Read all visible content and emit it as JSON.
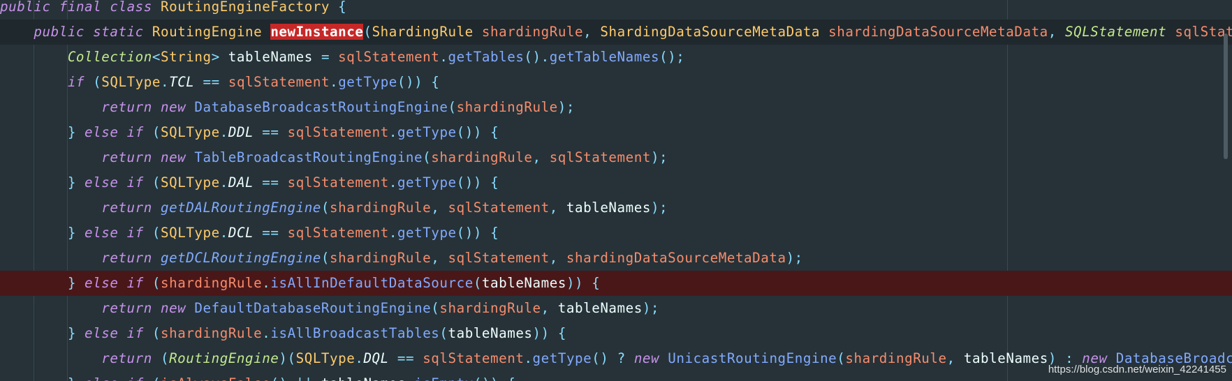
{
  "editor": {
    "lines": [
      {
        "tokens": [
          [
            "kw",
            "public"
          ],
          [
            "plain",
            " "
          ],
          [
            "kw",
            "final"
          ],
          [
            "plain",
            " "
          ],
          [
            "kw",
            "class"
          ],
          [
            "plain",
            " "
          ],
          [
            "type",
            "RoutingEngineFactory"
          ],
          [
            "plain",
            " "
          ],
          [
            "punc",
            "{"
          ]
        ]
      },
      {
        "tokens": [
          [
            "plain",
            "    "
          ],
          [
            "kw",
            "public"
          ],
          [
            "plain",
            " "
          ],
          [
            "kw",
            "static"
          ],
          [
            "plain",
            " "
          ],
          [
            "type",
            "RoutingEngine"
          ],
          [
            "plain",
            " "
          ],
          [
            "hl",
            "newInstance"
          ],
          [
            "punc",
            "("
          ],
          [
            "type",
            "ShardingRule"
          ],
          [
            "plain",
            " "
          ],
          [
            "var",
            "shardingRule"
          ],
          [
            "punc",
            ","
          ],
          [
            "plain",
            " "
          ],
          [
            "type",
            "ShardingDataSourceMetaData"
          ],
          [
            "plain",
            " "
          ],
          [
            "var",
            "shardingDataSourceMetaData"
          ],
          [
            "punc",
            ","
          ],
          [
            "plain",
            " "
          ],
          [
            "itype",
            "SQLStatement"
          ],
          [
            "plain",
            " "
          ],
          [
            "var",
            "sqlStatement"
          ]
        ]
      },
      {
        "tokens": [
          [
            "plain",
            "        "
          ],
          [
            "itype",
            "Collection"
          ],
          [
            "punc",
            "<"
          ],
          [
            "type",
            "String"
          ],
          [
            "punc",
            ">"
          ],
          [
            "plain",
            " tableNames "
          ],
          [
            "punc",
            "="
          ],
          [
            "plain",
            " "
          ],
          [
            "var",
            "sqlStatement"
          ],
          [
            "punc",
            "."
          ],
          [
            "fn",
            "getTables"
          ],
          [
            "punc",
            "()."
          ],
          [
            "fn",
            "getTableNames"
          ],
          [
            "punc",
            "();"
          ]
        ]
      },
      {
        "tokens": [
          [
            "plain",
            "        "
          ],
          [
            "kw",
            "if"
          ],
          [
            "plain",
            " "
          ],
          [
            "punc",
            "("
          ],
          [
            "type",
            "SQLType"
          ],
          [
            "punc",
            "."
          ],
          [
            "cst",
            "TCL"
          ],
          [
            "plain",
            " "
          ],
          [
            "punc",
            "=="
          ],
          [
            "plain",
            " "
          ],
          [
            "var",
            "sqlStatement"
          ],
          [
            "punc",
            "."
          ],
          [
            "fn",
            "getType"
          ],
          [
            "punc",
            "())"
          ],
          [
            "plain",
            " "
          ],
          [
            "punc",
            "{"
          ]
        ]
      },
      {
        "tokens": [
          [
            "plain",
            "            "
          ],
          [
            "kw",
            "return"
          ],
          [
            "plain",
            " "
          ],
          [
            "kw",
            "new"
          ],
          [
            "plain",
            " "
          ],
          [
            "cls",
            "DatabaseBroadcastRoutingEngine"
          ],
          [
            "punc",
            "("
          ],
          [
            "var",
            "shardingRule"
          ],
          [
            "punc",
            ");"
          ]
        ]
      },
      {
        "tokens": [
          [
            "plain",
            "        "
          ],
          [
            "punc",
            "}"
          ],
          [
            "plain",
            " "
          ],
          [
            "kw",
            "else"
          ],
          [
            "plain",
            " "
          ],
          [
            "kw",
            "if"
          ],
          [
            "plain",
            " "
          ],
          [
            "punc",
            "("
          ],
          [
            "type",
            "SQLType"
          ],
          [
            "punc",
            "."
          ],
          [
            "cst",
            "DDL"
          ],
          [
            "plain",
            " "
          ],
          [
            "punc",
            "=="
          ],
          [
            "plain",
            " "
          ],
          [
            "var",
            "sqlStatement"
          ],
          [
            "punc",
            "."
          ],
          [
            "fn",
            "getType"
          ],
          [
            "punc",
            "())"
          ],
          [
            "plain",
            " "
          ],
          [
            "punc",
            "{"
          ]
        ]
      },
      {
        "tokens": [
          [
            "plain",
            "            "
          ],
          [
            "kw",
            "return"
          ],
          [
            "plain",
            " "
          ],
          [
            "kw",
            "new"
          ],
          [
            "plain",
            " "
          ],
          [
            "cls",
            "TableBroadcastRoutingEngine"
          ],
          [
            "punc",
            "("
          ],
          [
            "var",
            "shardingRule"
          ],
          [
            "punc",
            ","
          ],
          [
            "plain",
            " "
          ],
          [
            "var",
            "sqlStatement"
          ],
          [
            "punc",
            ");"
          ]
        ]
      },
      {
        "tokens": [
          [
            "plain",
            "        "
          ],
          [
            "punc",
            "}"
          ],
          [
            "plain",
            " "
          ],
          [
            "kw",
            "else"
          ],
          [
            "plain",
            " "
          ],
          [
            "kw",
            "if"
          ],
          [
            "plain",
            " "
          ],
          [
            "punc",
            "("
          ],
          [
            "type",
            "SQLType"
          ],
          [
            "punc",
            "."
          ],
          [
            "cst",
            "DAL"
          ],
          [
            "plain",
            " "
          ],
          [
            "punc",
            "=="
          ],
          [
            "plain",
            " "
          ],
          [
            "var",
            "sqlStatement"
          ],
          [
            "punc",
            "."
          ],
          [
            "fn",
            "getType"
          ],
          [
            "punc",
            "())"
          ],
          [
            "plain",
            " "
          ],
          [
            "punc",
            "{"
          ]
        ]
      },
      {
        "tokens": [
          [
            "plain",
            "            "
          ],
          [
            "kw",
            "return"
          ],
          [
            "plain",
            " "
          ],
          [
            "ifn",
            "getDALRoutingEngine"
          ],
          [
            "punc",
            "("
          ],
          [
            "var",
            "shardingRule"
          ],
          [
            "punc",
            ","
          ],
          [
            "plain",
            " "
          ],
          [
            "var",
            "sqlStatement"
          ],
          [
            "punc",
            ","
          ],
          [
            "plain",
            " tableNames"
          ],
          [
            "punc",
            ");"
          ]
        ]
      },
      {
        "tokens": [
          [
            "plain",
            "        "
          ],
          [
            "punc",
            "}"
          ],
          [
            "plain",
            " "
          ],
          [
            "kw",
            "else"
          ],
          [
            "plain",
            " "
          ],
          [
            "kw",
            "if"
          ],
          [
            "plain",
            " "
          ],
          [
            "punc",
            "("
          ],
          [
            "type",
            "SQLType"
          ],
          [
            "punc",
            "."
          ],
          [
            "cst",
            "DCL"
          ],
          [
            "plain",
            " "
          ],
          [
            "punc",
            "=="
          ],
          [
            "plain",
            " "
          ],
          [
            "var",
            "sqlStatement"
          ],
          [
            "punc",
            "."
          ],
          [
            "fn",
            "getType"
          ],
          [
            "punc",
            "())"
          ],
          [
            "plain",
            " "
          ],
          [
            "punc",
            "{"
          ]
        ]
      },
      {
        "tokens": [
          [
            "plain",
            "            "
          ],
          [
            "kw",
            "return"
          ],
          [
            "plain",
            " "
          ],
          [
            "ifn",
            "getDCLRoutingEngine"
          ],
          [
            "punc",
            "("
          ],
          [
            "var",
            "shardingRule"
          ],
          [
            "punc",
            ","
          ],
          [
            "plain",
            " "
          ],
          [
            "var",
            "sqlStatement"
          ],
          [
            "punc",
            ","
          ],
          [
            "plain",
            " "
          ],
          [
            "var",
            "shardingDataSourceMetaData"
          ],
          [
            "punc",
            ");"
          ]
        ]
      },
      {
        "tokens": [
          [
            "plain",
            "        "
          ],
          [
            "punc",
            "}"
          ],
          [
            "plain",
            " "
          ],
          [
            "kw",
            "else"
          ],
          [
            "plain",
            " "
          ],
          [
            "kw",
            "if"
          ],
          [
            "plain",
            " "
          ],
          [
            "punc",
            "("
          ],
          [
            "var",
            "shardingRule"
          ],
          [
            "punc",
            "."
          ],
          [
            "fn",
            "isAllInDefaultDataSource"
          ],
          [
            "punc",
            "("
          ],
          [
            "plain",
            "tableNames"
          ],
          [
            "punc",
            "))"
          ],
          [
            "plain",
            " "
          ],
          [
            "punc",
            "{"
          ]
        ]
      },
      {
        "tokens": [
          [
            "plain",
            "            "
          ],
          [
            "kw",
            "return"
          ],
          [
            "plain",
            " "
          ],
          [
            "kw",
            "new"
          ],
          [
            "plain",
            " "
          ],
          [
            "cls",
            "DefaultDatabaseRoutingEngine"
          ],
          [
            "punc",
            "("
          ],
          [
            "var",
            "shardingRule"
          ],
          [
            "punc",
            ","
          ],
          [
            "plain",
            " tableNames"
          ],
          [
            "punc",
            ");"
          ]
        ]
      },
      {
        "tokens": [
          [
            "plain",
            "        "
          ],
          [
            "punc",
            "}"
          ],
          [
            "plain",
            " "
          ],
          [
            "kw",
            "else"
          ],
          [
            "plain",
            " "
          ],
          [
            "kw",
            "if"
          ],
          [
            "plain",
            " "
          ],
          [
            "punc",
            "("
          ],
          [
            "var",
            "shardingRule"
          ],
          [
            "punc",
            "."
          ],
          [
            "fn",
            "isAllBroadcastTables"
          ],
          [
            "punc",
            "("
          ],
          [
            "plain",
            "tableNames"
          ],
          [
            "punc",
            "))"
          ],
          [
            "plain",
            " "
          ],
          [
            "punc",
            "{"
          ]
        ]
      },
      {
        "tokens": [
          [
            "plain",
            "            "
          ],
          [
            "kw",
            "return"
          ],
          [
            "plain",
            " "
          ],
          [
            "punc",
            "("
          ],
          [
            "itype",
            "RoutingEngine"
          ],
          [
            "punc",
            ")("
          ],
          [
            "type",
            "SQLType"
          ],
          [
            "punc",
            "."
          ],
          [
            "cst",
            "DQL"
          ],
          [
            "plain",
            " "
          ],
          [
            "punc",
            "=="
          ],
          [
            "plain",
            " "
          ],
          [
            "var",
            "sqlStatement"
          ],
          [
            "punc",
            "."
          ],
          [
            "fn",
            "getType"
          ],
          [
            "punc",
            "()"
          ],
          [
            "plain",
            " "
          ],
          [
            "punc",
            "?"
          ],
          [
            "plain",
            " "
          ],
          [
            "kw",
            "new"
          ],
          [
            "plain",
            " "
          ],
          [
            "cls",
            "UnicastRoutingEngine"
          ],
          [
            "punc",
            "("
          ],
          [
            "var",
            "shardingRule"
          ],
          [
            "punc",
            ","
          ],
          [
            "plain",
            " tableNames"
          ],
          [
            "punc",
            ")"
          ],
          [
            "plain",
            " "
          ],
          [
            "punc",
            ":"
          ],
          [
            "plain",
            " "
          ],
          [
            "kw",
            "new"
          ],
          [
            "plain",
            " "
          ],
          [
            "cls",
            "DatabaseBroadcastRoutingEngine"
          ]
        ]
      },
      {
        "tokens": [
          [
            "plain",
            "        "
          ],
          [
            "punc",
            "}"
          ],
          [
            "plain",
            " "
          ],
          [
            "kw",
            "else"
          ],
          [
            "plain",
            " "
          ],
          [
            "kw",
            "if"
          ],
          [
            "plain",
            " "
          ],
          [
            "punc",
            "("
          ],
          [
            "var",
            "isAlwaysFalse"
          ],
          [
            "punc",
            "()"
          ],
          [
            "plain",
            " "
          ],
          [
            "punc",
            "||"
          ],
          [
            "plain",
            " tableNames"
          ],
          [
            "punc",
            "."
          ],
          [
            "fn",
            "isEmpty"
          ],
          [
            "punc",
            "())"
          ],
          [
            "plain",
            " "
          ],
          [
            "punc",
            "{"
          ]
        ]
      }
    ]
  },
  "watermark": "https://blog.csdn.net/weixin_42241455"
}
